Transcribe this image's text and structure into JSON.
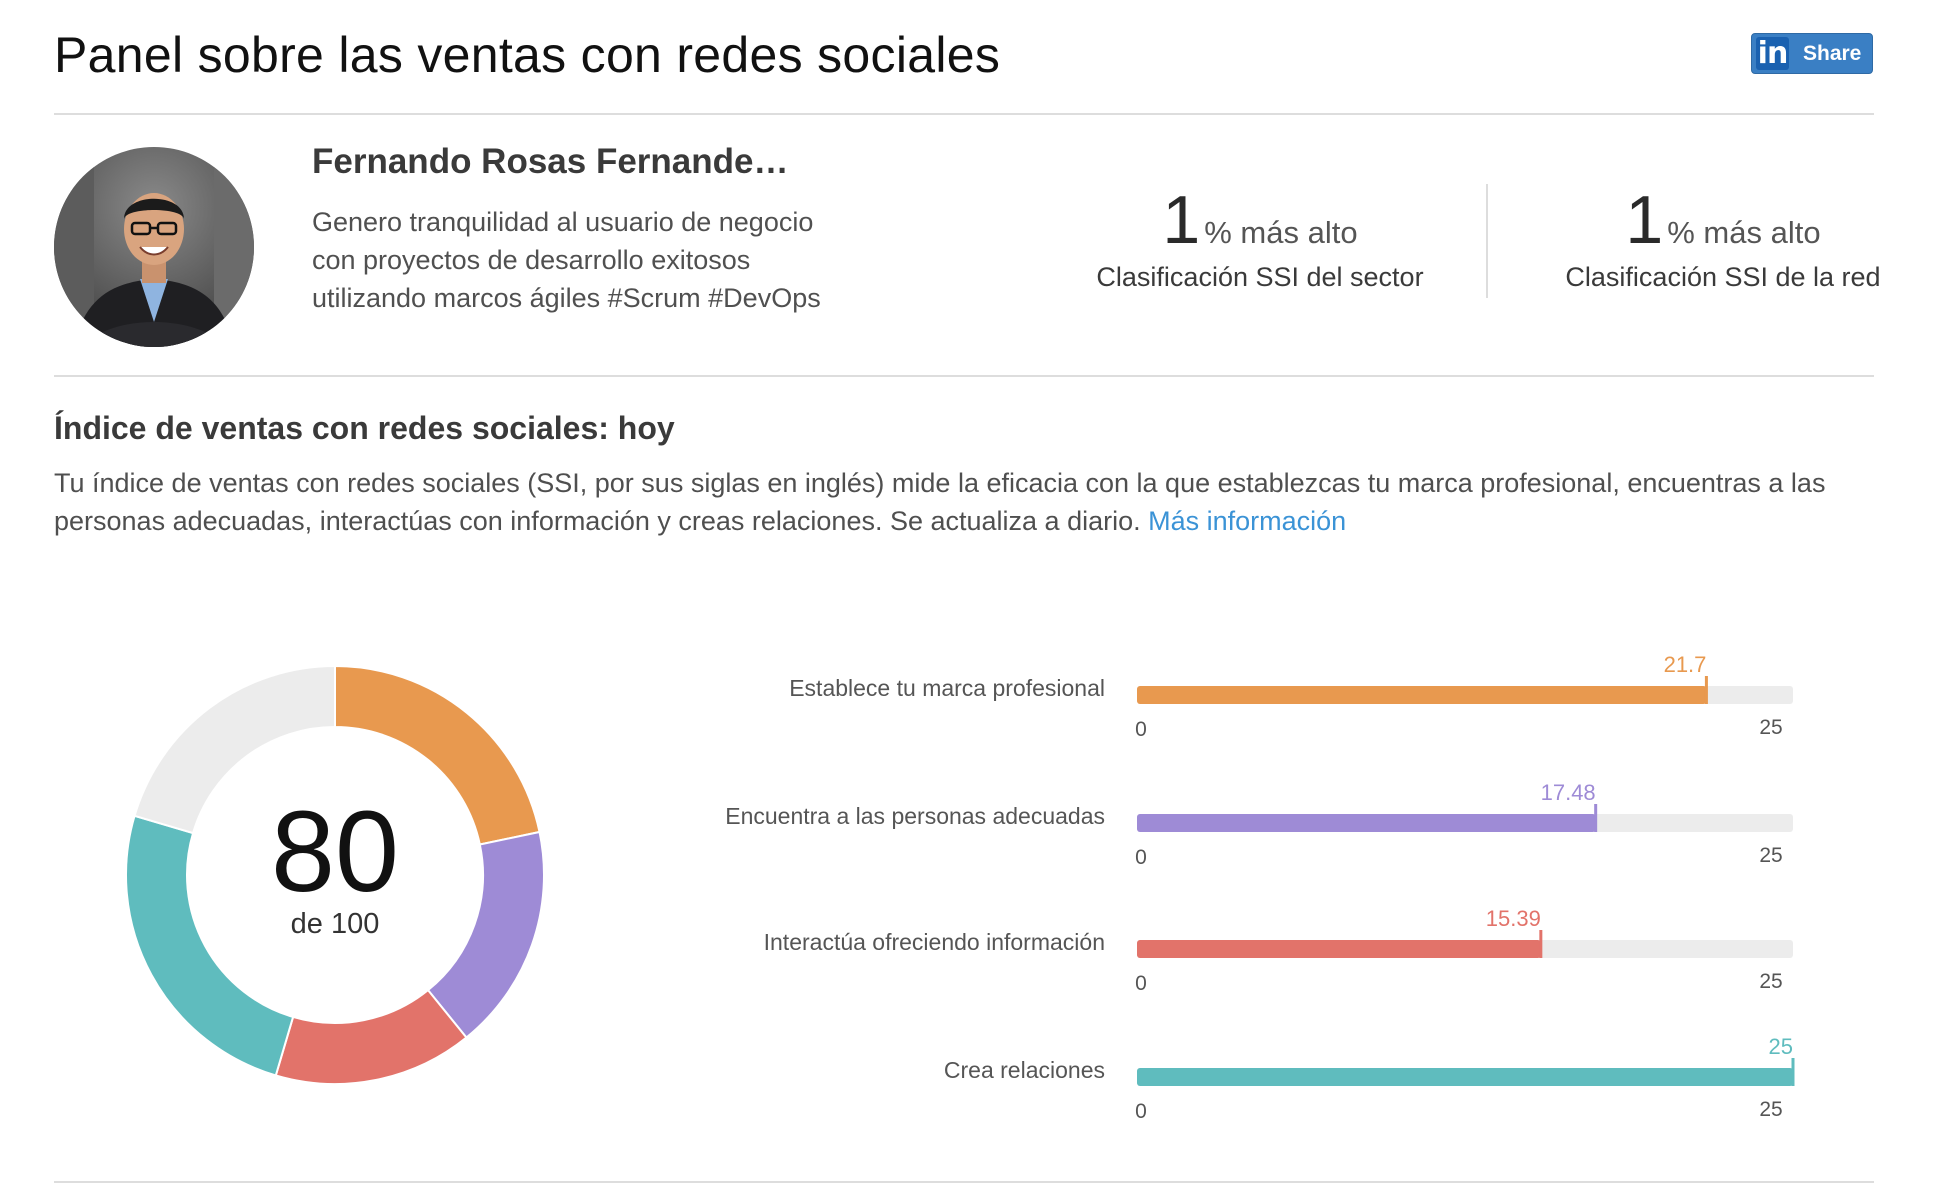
{
  "header": {
    "title": "Panel sobre las ventas con redes sociales",
    "share": {
      "logo_text": "in",
      "label": "Share",
      "logo_icon": "linkedin-logo-icon"
    }
  },
  "profile": {
    "name": "Fernando Rosas Fernande…",
    "headline": "Genero tranquilidad al usuario de negocio con proyectos de desarrollo exitosos utilizando marcos ágiles #Scrum #DevOps"
  },
  "rankings": [
    {
      "value": "1",
      "suffix": "% más alto",
      "label": "Clasificación SSI del sector"
    },
    {
      "value": "1",
      "suffix": "% más alto",
      "label": "Clasificación SSI de la red"
    }
  ],
  "ssi": {
    "title": "Índice de ventas con redes sociales: hoy",
    "description": "Tu índice de ventas con redes sociales (SSI, por sus siglas en inglés) mide la eficacia con la que establezcas tu marca profesional, encuentras a las personas adecuadas, interactúas con información y creas relaciones. Se actualiza a diario.",
    "more_link": "Más información",
    "score": "80",
    "out_of": "de 100"
  },
  "chart_data": {
    "type": "bar",
    "orientation": "horizontal",
    "categories": [
      "Establece tu marca profesional",
      "Encuentra a las personas adecuadas",
      "Interactúa ofreciendo información",
      "Crea relaciones"
    ],
    "values": [
      21.7,
      17.48,
      15.39,
      25
    ],
    "value_labels": [
      "21.7",
      "17.48",
      "15.39",
      "25"
    ],
    "colors": [
      "#e8994f",
      "#9e8bd6",
      "#e2736a",
      "#5fbcbe"
    ],
    "track_color": "#ececec",
    "xlim": [
      0,
      25
    ],
    "tick_labels": [
      "0",
      "25"
    ],
    "donut": {
      "total": 100,
      "values": [
        21.7,
        17.48,
        15.39,
        25
      ],
      "remainder_color": "#ececec"
    }
  }
}
